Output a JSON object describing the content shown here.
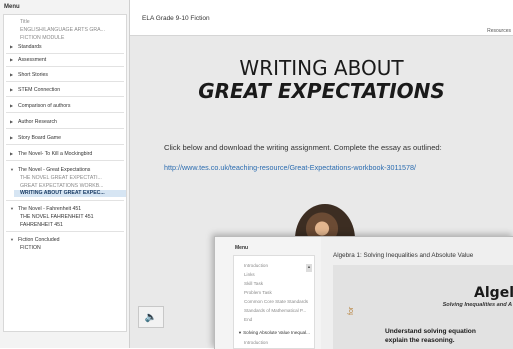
{
  "sidebar": {
    "title": "Menu",
    "items": [
      {
        "label": "Title",
        "type": "sub"
      },
      {
        "label": "ENGLISH/LANGUAGE ARTS   GRA...",
        "type": "sub"
      },
      {
        "label": "FICTION MODULE",
        "type": "sub"
      },
      {
        "label": "Standards",
        "type": "top"
      },
      {
        "label": "Assessment",
        "type": "top"
      },
      {
        "label": "Short Stories",
        "type": "top"
      },
      {
        "label": "STEM Connection",
        "type": "top"
      },
      {
        "label": "Comparison of authors",
        "type": "top"
      },
      {
        "label": "Author Research",
        "type": "top"
      },
      {
        "label": "Story Board Game",
        "type": "top"
      },
      {
        "label": "The Novel- To Kill a Mockingbird",
        "type": "top"
      },
      {
        "label": "The Novel - Great Expectations",
        "type": "top-open"
      },
      {
        "label": "THE NOVEL   GREAT EXPECTATI...",
        "type": "sub"
      },
      {
        "label": "GREAT EXPECTATIONS  WORKB...",
        "type": "sub"
      },
      {
        "label": "WRITING ABOUT  GREAT EXPEC...",
        "type": "selected"
      },
      {
        "label": "The Novel - Fahrenheit 451",
        "type": "top-open"
      },
      {
        "label": "THE NOVEL FAHRENHEIT 451",
        "type": "sub-dark"
      },
      {
        "label": "FAHRENHEIT 451",
        "type": "sub-dark"
      },
      {
        "label": "Fiction Concluded",
        "type": "top-open"
      },
      {
        "label": "FICTION",
        "type": "sub-dark"
      }
    ]
  },
  "header": {
    "course_title": "ELA Grade 9-10 Fiction",
    "resources": "Resources"
  },
  "slide": {
    "heading1": "WRITING ABOUT",
    "heading2": "GREAT EXPECTATIONS",
    "instruction": "Click below and download the writing assignment.  Complete the essay as  outlined:",
    "link": "http://www.tes.co.uk/teaching-resource/Great-Expectations-workbook-3011578/"
  },
  "audio_icon": "speaker-icon",
  "overlay": {
    "menu_title": "Menu",
    "menu_items": [
      {
        "label": "Introduction"
      },
      {
        "label": "Links"
      },
      {
        "label": "Skill Task"
      },
      {
        "label": "Problem Task"
      },
      {
        "label": "Common Core State Standards"
      },
      {
        "label": "Standards of Mathematical P..."
      },
      {
        "label": "End"
      },
      {
        "label": "Solving Absolute Value Inequal..."
      },
      {
        "label": "Introduction"
      }
    ],
    "course_title": "Algebra 1:  Solving Inequalities and Absolute Value",
    "slide_title": "Algel",
    "slide_subtitle": "Solving Inequalities and A",
    "text_line1": "Understand solving equation",
    "text_line2": "explain the reasoning.",
    "vertical_text": "for"
  },
  "colors": {
    "link": "#2b6cb0",
    "selected_bg": "#d6e5f3",
    "content_bg": "#e9e9e9"
  }
}
